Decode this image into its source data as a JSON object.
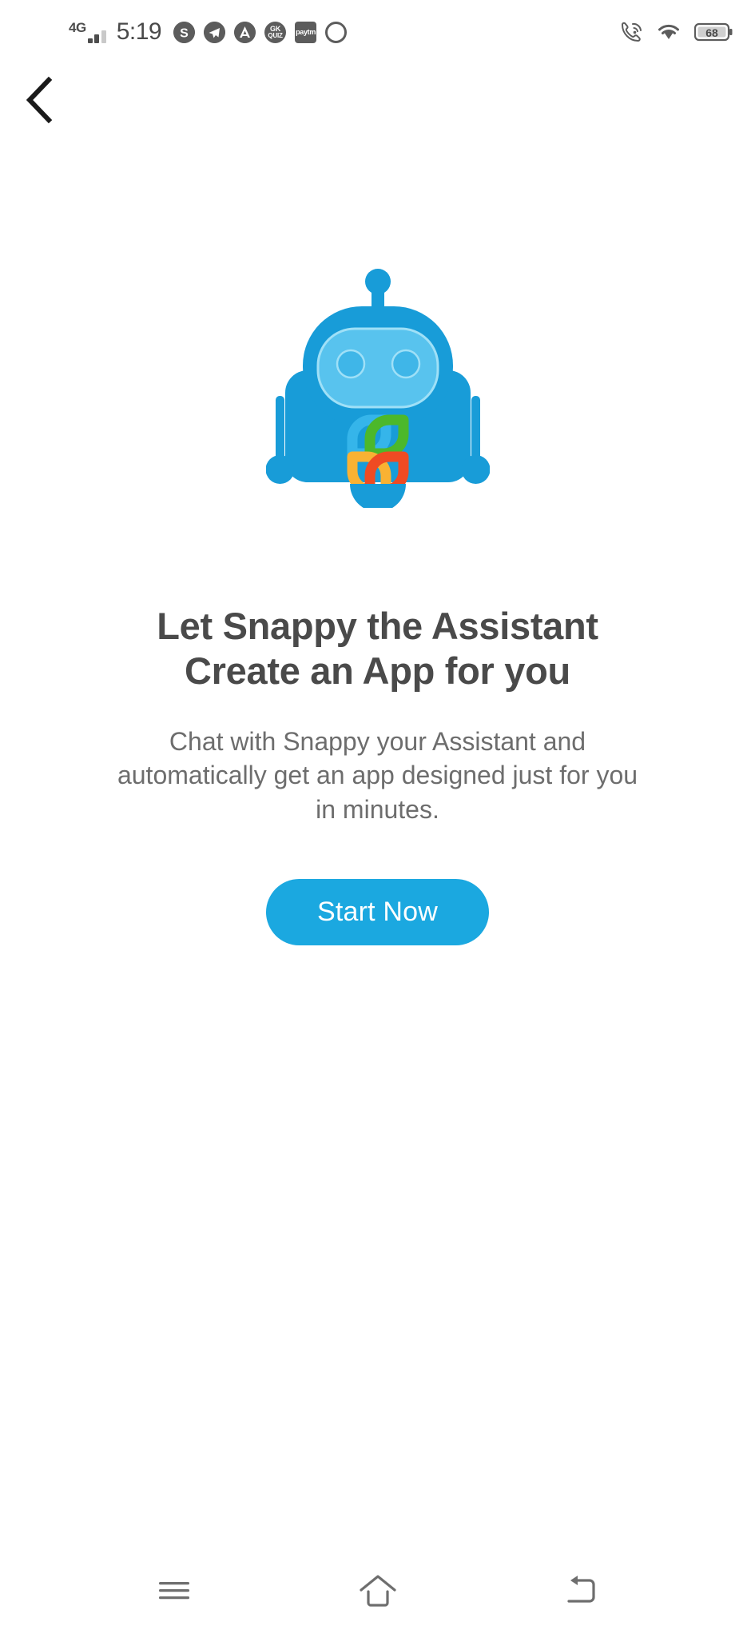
{
  "status_bar": {
    "network_type": "4G",
    "time": "5:19",
    "battery_percent": "68",
    "tray_icons": [
      {
        "name": "skype-icon",
        "glyph": "S"
      },
      {
        "name": "telegram-icon",
        "glyph": "➤"
      },
      {
        "name": "adaway-icon",
        "glyph": "A"
      },
      {
        "name": "gk-quiz-icon",
        "top": "GK",
        "bottom": "QUIZ"
      },
      {
        "name": "paytm-icon",
        "glyph": "paytm"
      },
      {
        "name": "alarm-icon",
        "glyph": ""
      }
    ],
    "right_icons": [
      {
        "name": "call-wifi-icon"
      },
      {
        "name": "wifi-icon"
      },
      {
        "name": "battery-icon"
      }
    ]
  },
  "header": {
    "back_label": "Back"
  },
  "hero": {
    "mascot_name": "Snappy",
    "mascot_alt": "snappy-robot-mascot",
    "headline": "Let Snappy the Assistant Create an App for you",
    "subtext": "Chat with Snappy your Assistant and automatically get an app designed just for you in minutes.",
    "cta_label": "Start Now"
  },
  "colors": {
    "brand_blue": "#1BA8E0",
    "robot_body": "#189CD8",
    "robot_face": "#58C3EE",
    "logo_blue": "#35B5EA",
    "logo_green": "#4CB82B",
    "logo_yellow": "#F9B233",
    "logo_red": "#EF4B23",
    "headline_gray": "#4A4A4A",
    "subtext_gray": "#6D6D6D"
  },
  "nav_bar": {
    "items": [
      {
        "name": "recents-button",
        "icon": "menu-icon"
      },
      {
        "name": "home-button",
        "icon": "home-icon"
      },
      {
        "name": "back-button",
        "icon": "back-arrow-icon"
      }
    ]
  }
}
